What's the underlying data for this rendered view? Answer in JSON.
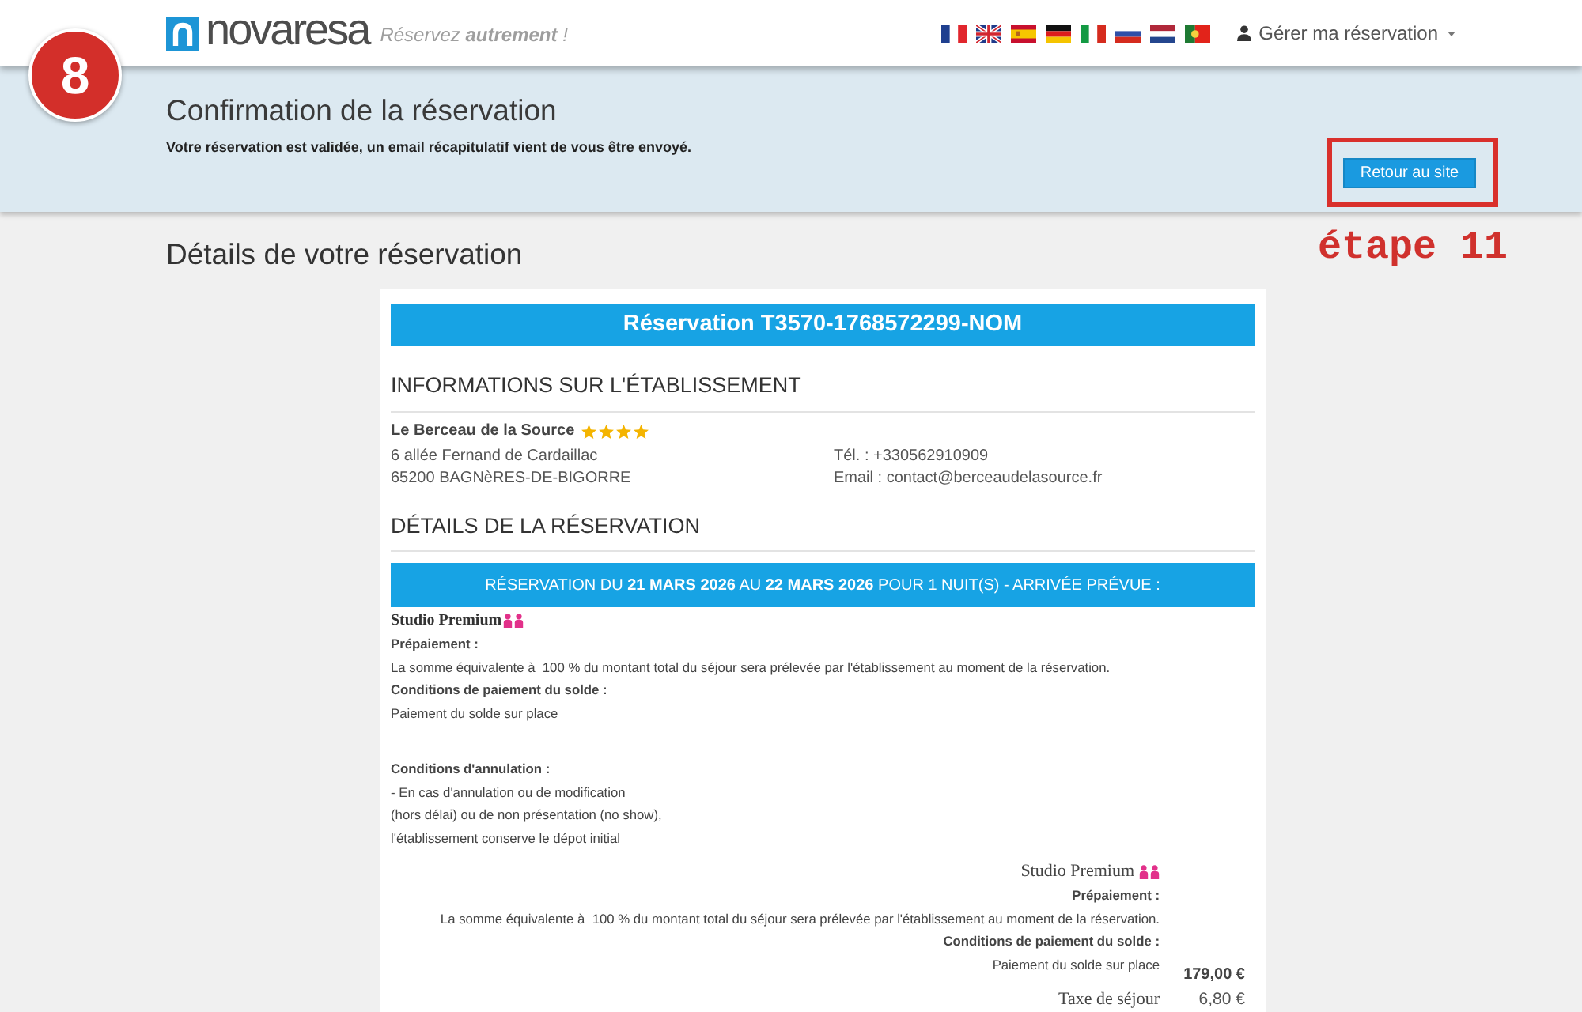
{
  "annotations": {
    "step_number": "8",
    "step_label": "étape 11"
  },
  "header": {
    "logo_wordmark": "novaresa",
    "tagline": "Réservez **autrement** !",
    "account_menu": "Gérer ma réservation"
  },
  "banner": {
    "title": "Confirmation de la réservation",
    "message": "Votre réservation est validée, un email récapitulatif vient de vous être envoyé.",
    "button": {
      "label": "Retour au site",
      "highlighted": true
    }
  },
  "section_title": "Détails de votre réservation",
  "reservation": {
    "title": "Réservation T3570-1768572299-NOM",
    "establishment": {
      "heading": "INFORMATIONS SUR L'ÉTABLISSEMENT",
      "name": "Le Berceau de la Source",
      "stars": 4,
      "address_lines": [
        "6 allée Fernand de Cardaillac",
        "65200 BAGNèRES-DE-BIGORRE"
      ],
      "contact_lines": [
        "Tél. : +330562910909",
        "Email : contact@berceaudelasource.fr"
      ]
    },
    "details": {
      "heading": "DÉTAILS DE LA RÉSERVATION",
      "stay": "RÉSERVATION DU **21 MARS 2026** AU **22 MARS 2026** POUR 1 NUIT(S) - ARRIVÉE PRÉVUE :",
      "room": {
        "name": "Studio Premium",
        "conditions": [
          {
            "kind": "payment",
            "label": "Prépaiement :",
            "lines": [
              "La somme équivalente à  100 % du montant total du séjour sera prélevée par l'établissement au moment de la réservation."
            ]
          },
          {
            "kind": "payment",
            "label": "Conditions de paiement du solde :",
            "lines": [
              "Paiement du solde sur place"
            ]
          },
          {
            "kind": "cancellation",
            "label": "Conditions d'annulation :",
            "lines": [
              "- En cas d'annulation ou de modification",
              "(hors délai) ou de non présentation (no show),",
              "l'établissement conserve le dépot initial"
            ]
          }
        ]
      },
      "summary": {
        "room_name": "Studio Premium",
        "conditions": [
          {
            "label": "Prépaiement :",
            "lines": [
              "La somme équivalente à  100 % du montant total du séjour sera prélevée par l'établissement au moment de la réservation."
            ]
          },
          {
            "label": "Conditions de paiement du solde :",
            "lines": [
              "Paiement du solde sur place"
            ]
          }
        ],
        "price": "179,00 €"
      },
      "charges": [
        {
          "label": "Taxe de séjour",
          "amount": "6,80 €"
        }
      ]
    }
  }
}
